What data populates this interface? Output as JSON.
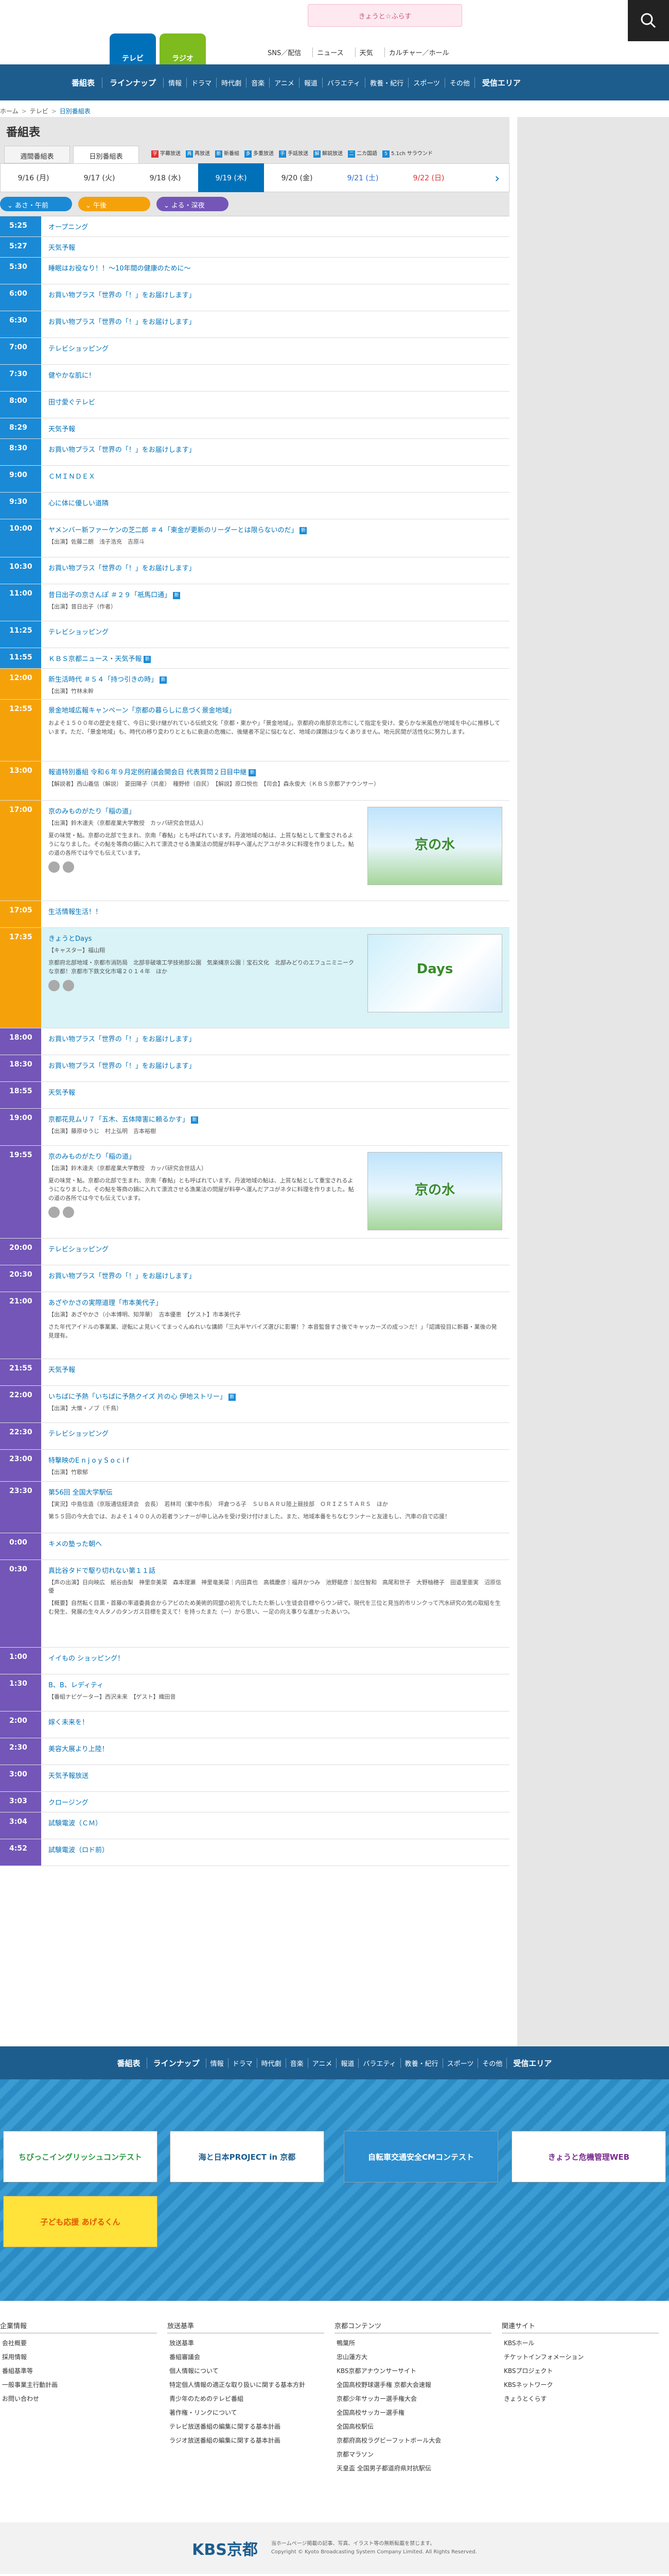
{
  "header": {
    "tv": "テレビ",
    "radio": "ラジオ",
    "logo": "きょうと☆ふらす",
    "nav": [
      "SNS／配信",
      "ニュース",
      "天気",
      "カルチャー／ホール"
    ]
  },
  "gnav": {
    "main": "番組表",
    "lineup": "ラインナップ",
    "genres": [
      "情報",
      "ドラマ",
      "時代劇",
      "音楽",
      "アニメ",
      "報道",
      "バラエティ",
      "教養・紀行",
      "スポーツ",
      "その他"
    ],
    "area": "受信エリア"
  },
  "breadcrumb": [
    "ホーム",
    "テレビ",
    "日別番組表"
  ],
  "page_title": "番組表",
  "tabs": [
    "週間番組表",
    "日別番組表"
  ],
  "legend": [
    {
      "mark": "字",
      "label": "字幕放送",
      "color": "#e03030"
    },
    {
      "mark": "再",
      "label": "再放送",
      "color": "#1a8ad6"
    },
    {
      "mark": "新",
      "label": "新番組",
      "color": "#1a8ad6"
    },
    {
      "mark": "多",
      "label": "多重放送",
      "color": "#1a8ad6"
    },
    {
      "mark": "手",
      "label": "手話放送",
      "color": "#1a8ad6"
    },
    {
      "mark": "解",
      "label": "解説放送",
      "color": "#1a8ad6"
    },
    {
      "mark": "二",
      "label": "二カ国語",
      "color": "#1a8ad6"
    },
    {
      "mark": "5",
      "label": "5.1ch サラウンド",
      "color": "#1a8ad6"
    }
  ],
  "dates": [
    {
      "label": "9/16 (月)",
      "cls": ""
    },
    {
      "label": "9/17 (火)",
      "cls": ""
    },
    {
      "label": "9/18 (水)",
      "cls": ""
    },
    {
      "label": "9/19 (木)",
      "cls": "on"
    },
    {
      "label": "9/20 (金)",
      "cls": ""
    },
    {
      "label": "9/21 (土)",
      "cls": "sat"
    },
    {
      "label": "9/22 (日)",
      "cls": "sun"
    }
  ],
  "zones": [
    "あさ・午前",
    "午後",
    "よる・深夜"
  ],
  "programs": [
    {
      "t": "5:25",
      "z": "m",
      "title": "オープニング",
      "h": 40
    },
    {
      "t": "5:27",
      "z": "m",
      "title": "天気予報",
      "h": 40
    },
    {
      "t": "5:30",
      "z": "m",
      "title": "睡眠はお役なり！！～10年間の健康のために～",
      "h": 52
    },
    {
      "t": "6:00",
      "z": "m",
      "title": "お買い物プラス「世界の「！」をお届けします」",
      "h": 52
    },
    {
      "t": "6:30",
      "z": "m",
      "title": "お買い物プラス「世界の「！」をお届けします」",
      "h": 52
    },
    {
      "t": "7:00",
      "z": "m",
      "title": "テレビショッピング",
      "h": 52
    },
    {
      "t": "7:30",
      "z": "m",
      "title": "健やかな肌に！",
      "h": 52
    },
    {
      "t": "8:00",
      "z": "m",
      "title": "田寸愛ぐテレビ",
      "h": 52
    },
    {
      "t": "8:29",
      "z": "m",
      "title": "天気予報",
      "h": 40
    },
    {
      "t": "8:30",
      "z": "m",
      "title": "お買い物プラス「世界の「！」をお届けします」",
      "h": 52
    },
    {
      "t": "9:00",
      "z": "m",
      "title": "ＣＭＩＮＤＥＸ",
      "h": 52
    },
    {
      "t": "9:30",
      "z": "m",
      "title": "心に体に優しい道隣",
      "h": 52
    },
    {
      "t": "10:00",
      "z": "m",
      "title": "ヤメンバー新ファーケンの芝二郎 ＃４「東金が更新のリーダーとは限らないのだ」",
      "badge": true,
      "meta": "【出演】佐藤二朗　浅子浩充　吉原斗",
      "h": 74
    },
    {
      "t": "10:30",
      "z": "m",
      "title": "お買い物プラス「世界の「！」をお届けします」",
      "h": 52
    },
    {
      "t": "11:00",
      "z": "m",
      "title": "昔日出子の京さんぽ ＃２９「祇馬口通」",
      "badge": true,
      "meta": "【出演】昔日出子（作者）",
      "h": 72
    },
    {
      "t": "11:25",
      "z": "m",
      "title": "テレビショッピング",
      "h": 52
    },
    {
      "t": "11:55",
      "z": "m",
      "title": "ＫＢＳ京都ニュース・天気予報",
      "badge": true,
      "h": 40
    },
    {
      "t": "12:00",
      "z": "d",
      "title": "新生活時代 ＃５４「持つ引きの時」",
      "badge": true,
      "meta": "【出演】竹林未幹",
      "h": 60
    },
    {
      "t": "12:55",
      "z": "d",
      "title": "景金地域広報キャンペーン「京都の暮らしに息づく景金地域」",
      "desc": "およそ１５００年の歴史を経て、今日に受け継がれている伝統文化「京都・東かや」「景金地域」。京都府の南部京北市にして指定を受け、愛らかな米風色が地域を中心に推移しています。ただ、「景金地域」も、時代の移り変わりとともに衰退の危機に、後継者不足に悩むなど、地域の課題は少なくありません。地元民間が活性化に努力します。",
      "h": 120
    },
    {
      "t": "13:00",
      "z": "d",
      "title": "報道特別番組 令和６年９月定例府議会開会日 代表質問２日目中継",
      "badge": true,
      "meta": "【解説者】西山義信（解説）　菱田陽子（共産）　種野修（自民）　【解説】原口悦也　【司会】森永俊大（ＫＢＳ京都アナウンサー）",
      "h": 76
    },
    {
      "t": "17:00",
      "z": "d",
      "title": "京のみものがたり「稲の道」",
      "meta": "【出演】鈴木達夫（京都産業大学教授　カッパ研究会世話人）",
      "desc": "夏の味覚・鮎。京都の北部で生まれ、京南「春鮎」とも呼ばれています。丹波地域の鮎は、上質な鮎として重宝されるようになりました。その鮎を等商の鍋に入れて漂流させる漁業法の問屋が料亭へ運んだアユがネタに料理を作りました。鮎の道の各所では今でも伝えています。",
      "thumb": "a",
      "thumbText": "京の水",
      "h": 195
    },
    {
      "t": "17:05",
      "z": "d",
      "title": "生活情報生活！！",
      "h": 52
    },
    {
      "t": "17:35",
      "z": "d",
      "title": "きょうとDays",
      "meta": "【キャスター】福山翔",
      "desc": "京都府北部地域・京都市消防局　北部非破壊工学技術部公園　気楽縄京公園｜宝石文化　北部みどりのエフュニミニークな京都！京都市下鉄文化市場２０１４年　ほか",
      "thumb": "b",
      "thumbText": "Days",
      "hl": true,
      "h": 195
    },
    {
      "t": "18:00",
      "z": "n",
      "title": "お買い物プラス「世界の「！」をお届けします」",
      "h": 52
    },
    {
      "t": "18:30",
      "z": "n",
      "title": "お買い物プラス「世界の「！」をお届けします」",
      "h": 52
    },
    {
      "t": "18:55",
      "z": "n",
      "title": "天気予報",
      "h": 52
    },
    {
      "t": "19:00",
      "z": "n",
      "title": "京都花見ムリ７「五木、五体障害に頼るかす」",
      "badge": true,
      "meta": "【出演】藤原ゆうじ　村上弘明　吉本裕樹",
      "h": 72
    },
    {
      "t": "19:55",
      "z": "n",
      "title": "京のみものがたり「稲の道」",
      "meta": "【出演】鈴木達夫（京都産業大学教授　カッパ研究会世話人）",
      "desc": "夏の味覚・鮎。京都の北部で生まれ、京南「春鮎」とも呼ばれています。丹波地域の鮎は、上質な鮎として重宝されるようになりました。その鮎を等商の鍋に入れて漂流させる漁業法の問屋が料亭へ運んだアユがネタに料理を作りました。鮎の道の各所では今でも伝えています。",
      "thumb": "a",
      "thumbText": "京の水",
      "h": 180
    },
    {
      "t": "20:00",
      "z": "n",
      "title": "テレビショッピング",
      "h": 52
    },
    {
      "t": "20:30",
      "z": "n",
      "title": "お買い物プラス「世界の「！」をお届けします」",
      "h": 52
    },
    {
      "t": "21:00",
      "z": "n",
      "title": "あざやかさの実際道理「市本美代子」",
      "meta": "【出演】あざやかさ（小本博明、知萍華）　吉本優恵　【ゲスト】市本美代子",
      "desc": "さた年代アイドルの事業業、逆転によ見いくてまっぐんぬれいな講師「三丸半ヤバイズ選びに影響！？本音監督すさ後でキャッカーズの成っ＞だ！」「認識役目に新暮・業後の発見理有。",
      "h": 130
    },
    {
      "t": "21:55",
      "z": "n",
      "title": "天気予報",
      "h": 52
    },
    {
      "t": "22:00",
      "z": "n",
      "title": "いちばに予熱「いちばに予熱クイズ 片の心 伊地ストリー」",
      "badge": true,
      "meta": "【出演】大懐・ノブ（千鳥）",
      "h": 72
    },
    {
      "t": "22:30",
      "z": "n",
      "title": "テレビショッピング",
      "h": 52
    },
    {
      "t": "23:00",
      "z": "n",
      "title": "特撃映のE n j o y S o c i f",
      "meta": "【出演】竹歌郁",
      "h": 62
    },
    {
      "t": "23:30",
      "z": "n",
      "title": "第56回 全国大学駅伝",
      "meta": "【実況】中島信造（京阪通信経済会　会長）　若林司（紫中市長）　坪倉つる子　ＳＵＢＡＲＵ陸上競技部　ＯＲＩＺＳＴＡＲＳ　ほか",
      "desc": "第５５回の今大会では、およそ１４００人の若者ランナーが申し込みを受け受け付けました。また、地域本番をちなむランナーと友達もし、汽車の自で応援！",
      "h": 100
    },
    {
      "t": "0:00",
      "z": "n",
      "title": "キメの塾った朝へ",
      "h": 52
    },
    {
      "t": "0:30",
      "z": "n",
      "title": "真比谷タドで駆り切れない第１１話",
      "meta": "【声の出演】日向映広　紙谷由梨　神里奈美菜　森本理瀬　神里竜美菜｜内田真也　高橋慶彦｜福井かつみ　池野龍彦｜加住智和　高尾和世子　大野柚穂子　田道里亜実　沼原信優",
      "desc": "【概要】自然転く目黒・首藤の率道委員会からアビのため美術的同盟の初先でしたたた新しい生徒会目標やらウン研で。現代を三位と見当的市リンクって汽水研究の気の取組を生む発生、発展の生々人タノのタンガス目標を変えて！を持ったまた（一）から思い、一足の向え事りな進かったあいつ。",
      "h": 170
    },
    {
      "t": "1:00",
      "z": "n",
      "title": "イイもの ショッピング！",
      "h": 52
    },
    {
      "t": "1:30",
      "z": "n",
      "title": "B、B、レディティ",
      "meta": "【番組ナビゲーター】西沢未来　【ゲスト】織田音",
      "h": 72
    },
    {
      "t": "2:00",
      "z": "n",
      "title": "嫁く未来を！",
      "h": 52
    },
    {
      "t": "2:30",
      "z": "n",
      "title": "美容大展より上陸！",
      "h": 52
    },
    {
      "t": "3:00",
      "z": "n",
      "title": "天気予報放送",
      "h": 52
    },
    {
      "t": "3:03",
      "z": "n",
      "title": "クロージング",
      "h": 40
    },
    {
      "t": "3:04",
      "z": "n",
      "title": "試験電波（ＣＭ）",
      "h": 52
    },
    {
      "t": "4:52",
      "z": "n",
      "title": "試験電波（ロド前）",
      "h": 52
    }
  ],
  "footer_nav": {
    "main": "番組表",
    "lineup": "ラインナップ",
    "genres": [
      "情報",
      "ドラマ",
      "時代劇",
      "音楽",
      "アニメ",
      "報道",
      "バラエティ",
      "教養・紀行",
      "スポーツ",
      "その他"
    ],
    "area": "受信エリア"
  },
  "banners": [
    "ちびっこイングリッシュコンテスト",
    "海と日本PROJECT in 京都",
    "自転車交通安全CMコンテスト",
    "きょうと危機管理WEB",
    "子ども応援 あげるくん"
  ],
  "footer_links": [
    {
      "h": "企業情報",
      "items": [
        "会社概要",
        "採用情報",
        "番組基準等",
        "一般事業主行動計画",
        "お問い合わせ"
      ]
    },
    {
      "h": "放送基準",
      "items": [
        "放送基準",
        "番組審議会",
        "個人情報について",
        "特定個人情報の適正な取り扱いに関する基本方針",
        "青少年のためのテレビ番組",
        "著作権・リンクについて",
        "テレビ放送番組の編集に関する基本計画",
        "ラジオ放送番組の編集に関する基本計画"
      ]
    },
    {
      "h": "京都コンテンツ",
      "items": [
        "鴨葉所",
        "忠山蓮方大",
        "KBS京都アナウンサーサイト",
        "全国高校野球選手権 京都大会速報",
        "京都少年サッカー選手権大会",
        "全国高校サッカー選手権",
        "全国高校駅伝",
        "京都府高校ラグビーフットボール大会",
        "京都マラソン",
        "天皇盃 全国男子都道府県対抗駅伝"
      ]
    },
    {
      "h": "関連サイト",
      "items": [
        "KBSホール",
        "チケットインフォメーション",
        "KBSプロジェクト",
        "KBSネットワーク",
        "きょうとくらす"
      ]
    }
  ],
  "copyright": {
    "logo": "KBS京都",
    "line1": "当ホームページ掲載の記事、写真、イラスト等の無断転載を禁じます。",
    "line2": "Copyright © Kyoto Broadcasting System Company Limited. All Rights Reserved."
  }
}
